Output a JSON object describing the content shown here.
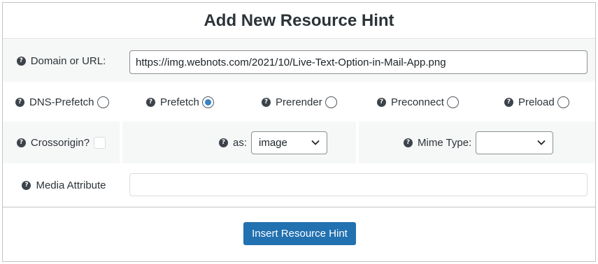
{
  "title": "Add New Resource Hint",
  "help_glyph": "?",
  "domain": {
    "label": "Domain or URL:",
    "value": "https://img.webnots.com/2021/10/Live-Text-Option-in-Mail-App.png"
  },
  "hint_types": [
    {
      "label": "DNS-Prefetch",
      "checked": false
    },
    {
      "label": "Prefetch",
      "checked": true
    },
    {
      "label": "Prerender",
      "checked": false
    },
    {
      "label": "Preconnect",
      "checked": false
    },
    {
      "label": "Preload",
      "checked": false
    }
  ],
  "crossorigin": {
    "label": "Crossorigin?",
    "checked": false
  },
  "as": {
    "label": "as:",
    "selected": "image"
  },
  "mime": {
    "label": "Mime Type:",
    "selected": ""
  },
  "media": {
    "label": "Media Attribute",
    "value": ""
  },
  "submit_label": "Insert Resource Hint",
  "colors": {
    "accent": "#2271b1",
    "radio_dot": "#3582c4",
    "row_bg": "#f6f7f7"
  }
}
